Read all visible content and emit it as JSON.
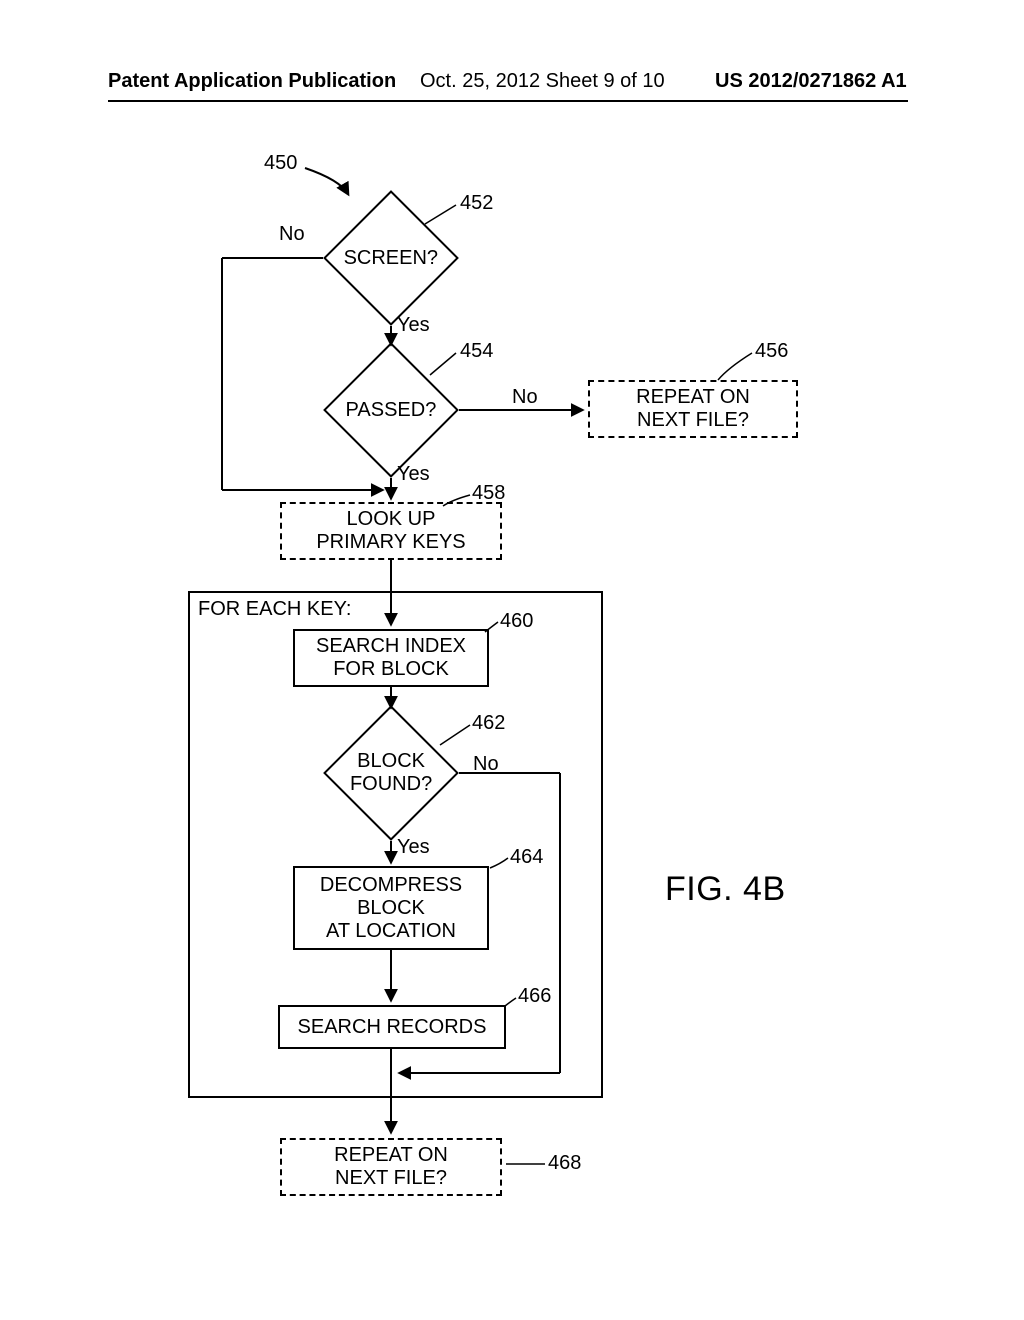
{
  "header": {
    "left": "Patent Application Publication",
    "center": "Oct. 25, 2012  Sheet 9 of 10",
    "right": "US 2012/0271862 A1"
  },
  "labels": {
    "ref450": "450",
    "ref452": "452",
    "ref454": "454",
    "ref456": "456",
    "ref458": "458",
    "ref460": "460",
    "ref462": "462",
    "ref464": "464",
    "ref466": "466",
    "ref468": "468",
    "no1": "No",
    "yes1": "Yes",
    "no2": "No",
    "yes2": "Yes",
    "no3": "No",
    "yes3": "Yes",
    "forEach": "FOR EACH KEY:",
    "figure": "FIG. 4B"
  },
  "nodes": {
    "screen": "SCREEN?",
    "passed": "PASSED?",
    "repeatNext1_l1": "REPEAT ON",
    "repeatNext1_l2": "NEXT FILE?",
    "lookup_l1": "LOOK UP",
    "lookup_l2": "PRIMARY KEYS",
    "searchIndex_l1": "SEARCH INDEX",
    "searchIndex_l2": "FOR BLOCK",
    "blockFound_l1": "BLOCK",
    "blockFound_l2": "FOUND?",
    "decompress_l1": "DECOMPRESS",
    "decompress_l2": "BLOCK",
    "decompress_l3": "AT LOCATION",
    "searchRecords": "SEARCH RECORDS",
    "repeatNext2_l1": "REPEAT ON",
    "repeatNext2_l2": "NEXT FILE?"
  }
}
